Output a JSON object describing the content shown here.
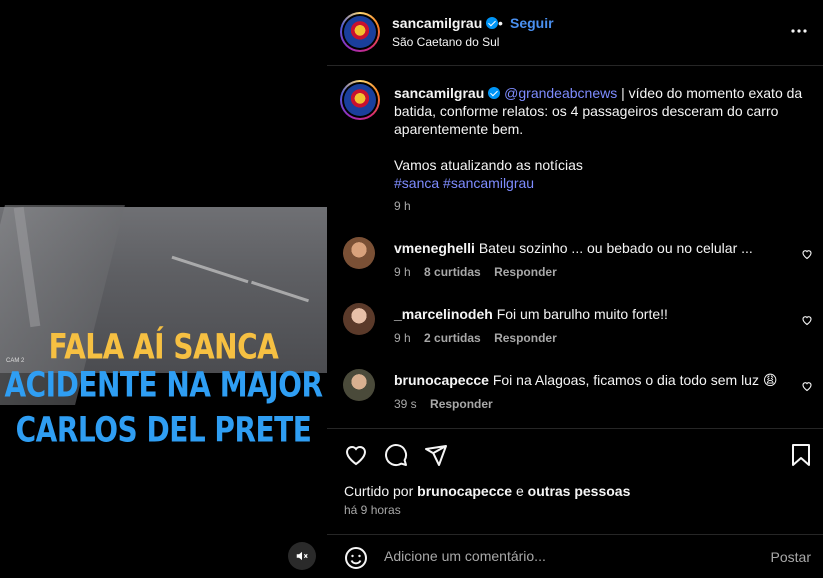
{
  "media": {
    "headline_line1": "FALA AÍ SANCA",
    "headline_line2": "ACIDENTE NA MAJOR",
    "headline_line3": "CARLOS DEL PRETE",
    "cam_label": "CAM 2",
    "mute_icon": "speaker-muted-icon"
  },
  "header": {
    "username": "sancamilgrau",
    "separator": "•",
    "follow_label": "Seguir",
    "location": "São Caetano do Sul",
    "more_icon": "more-options-icon"
  },
  "caption": {
    "username": "sancamilgrau",
    "mention": "@grandeabcnews",
    "text": " | vídeo do momento exato da batida, conforme relatos: os 4 passageiros desceram do carro aparentemente bem.",
    "text2": "Vamos atualizando as notícias",
    "hashtags": "#sanca #sancamilgrau",
    "time": "9 h"
  },
  "comments": [
    {
      "username": "vmeneghelli",
      "text": "Bateu sozinho ... ou bebado ou no celular ...",
      "time": "9 h",
      "likes": "8 curtidas",
      "reply": "Responder"
    },
    {
      "username": "_marcelinodeh",
      "text": "Foi um barulho muito forte!!",
      "time": "9 h",
      "likes": "2 curtidas",
      "reply": "Responder"
    },
    {
      "username": "brunocapecce",
      "text": "Foi na Alagoas, ficamos o dia todo sem luz 😩",
      "time": "39 s",
      "reply": "Responder"
    }
  ],
  "actions": {
    "icons": [
      "heart-icon",
      "comment-icon",
      "share-icon",
      "bookmark-icon"
    ]
  },
  "likes": {
    "prefix": "Curtido por",
    "user": "brunocapecce",
    "mid": "e",
    "others": "outras pessoas"
  },
  "post_time": "há 9 horas",
  "add_comment": {
    "placeholder": "Adicione um comentário...",
    "post_label": "Postar"
  },
  "colors": {
    "link": "#7e8cff",
    "follow": "#4a90f0",
    "verified": "#0095f6",
    "headline_yellow": "#f6c042",
    "headline_blue": "#2f9ef3"
  }
}
